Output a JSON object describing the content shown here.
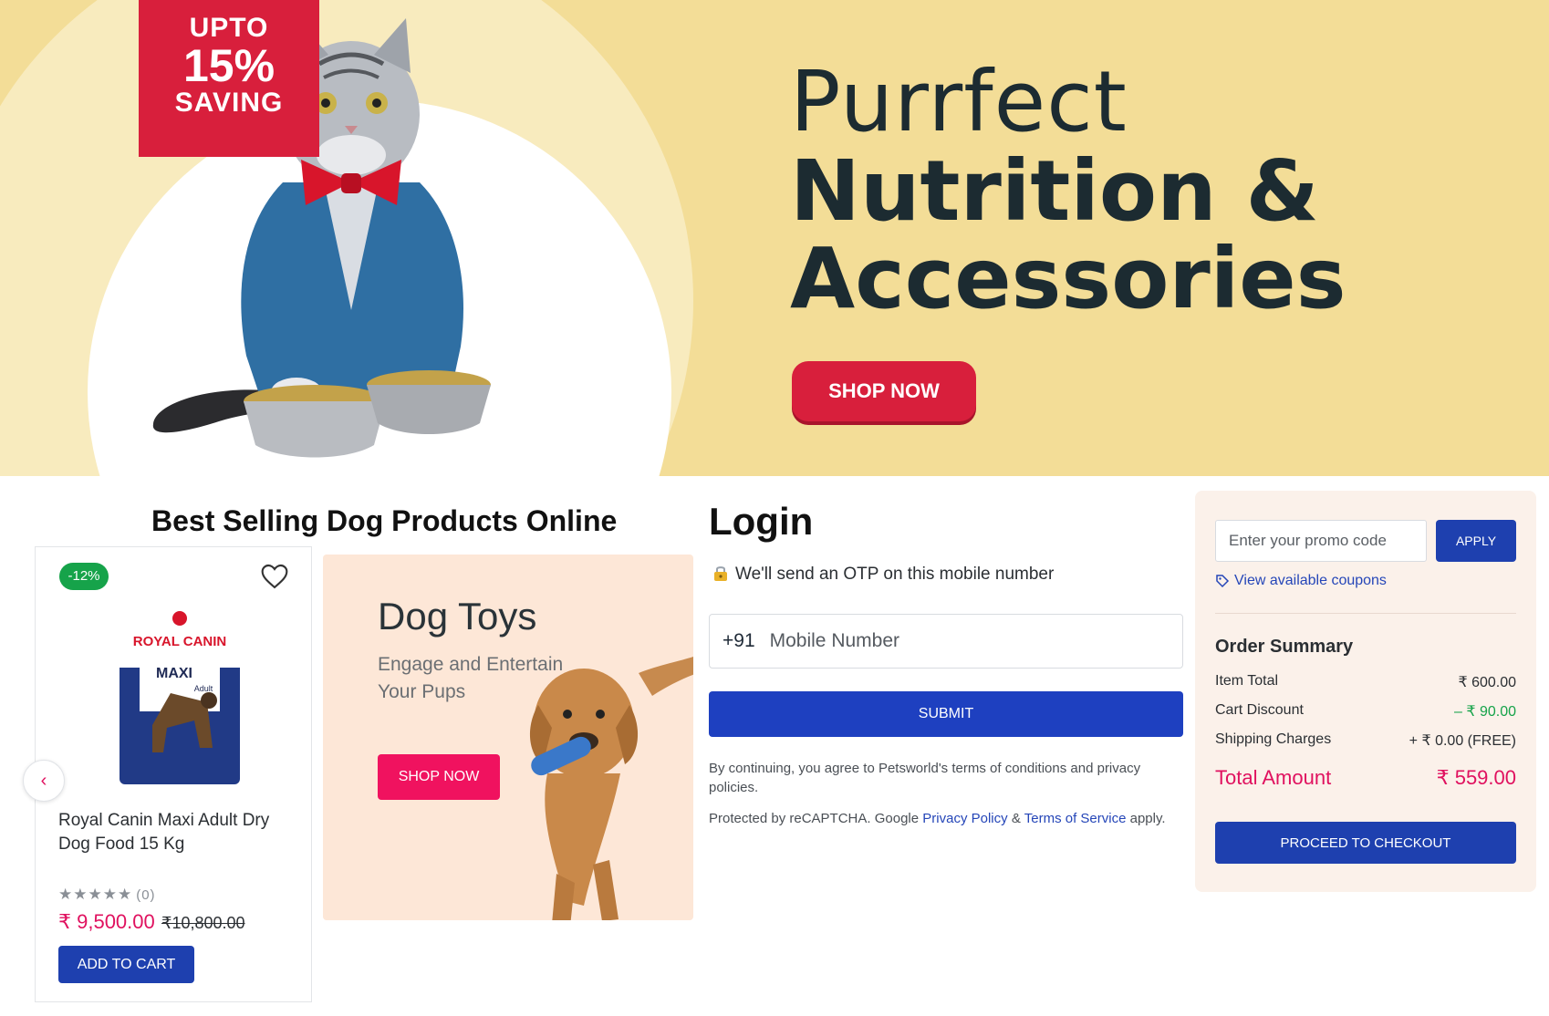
{
  "hero": {
    "ribbon_line1": "UPTO",
    "ribbon_line2": "15%",
    "ribbon_line3": "SAVING",
    "title_line1": "Purrfect",
    "title_line2": "Nutrition &",
    "title_line3": "Accessories",
    "shop_label": "SHOP NOW",
    "bg_color": "#f3dd97",
    "accent_color": "#d81f3c"
  },
  "best_selling": {
    "title": "Best Selling Dog Products Online",
    "product": {
      "discount": "-12%",
      "name": "Royal Canin Maxi Adult Dry Dog Food 15 Kg",
      "stars": "★★★★★",
      "rating_count": "(0)",
      "price": "₹ 9,500.00",
      "old_price": "₹10,800.00",
      "add_to_cart": "ADD TO CART",
      "brand_label": "ROYAL CANIN",
      "variant_label": "MAXI",
      "variant_sub": "Adult"
    },
    "prev_icon": "‹",
    "toys": {
      "title": "Dog Toys",
      "subtitle": "Engage and Entertain Your Pups",
      "shop_label": "SHOP NOW"
    }
  },
  "login": {
    "title": "Login",
    "otp_text": "We'll send an OTP on this mobile number",
    "country_code": "+91",
    "mobile_placeholder": "Mobile Number",
    "submit_label": "SUBMIT",
    "terms_text": "By continuing, you agree to Petsworld's terms of conditions and privacy policies.",
    "captcha_prefix": "Protected by reCAPTCHA. Google",
    "privacy_link": "Privacy Policy",
    "amp": "&",
    "terms_link": "Terms of Service",
    "captcha_suffix": "apply."
  },
  "order": {
    "promo_placeholder": "Enter your promo code",
    "apply_label": "APPLY",
    "coupons_link": "View available coupons",
    "summary_title": "Order Summary",
    "rows": [
      {
        "label": "Item Total",
        "value": "₹ 600.00"
      },
      {
        "label": "Cart Discount",
        "value": "– ₹ 90.00"
      },
      {
        "label": "Shipping Charges",
        "value": "+ ₹ 0.00 (FREE)"
      }
    ],
    "total_label": "Total Amount",
    "total_value": "₹ 559.00",
    "checkout_label": "PROCEED TO CHECKOUT"
  }
}
